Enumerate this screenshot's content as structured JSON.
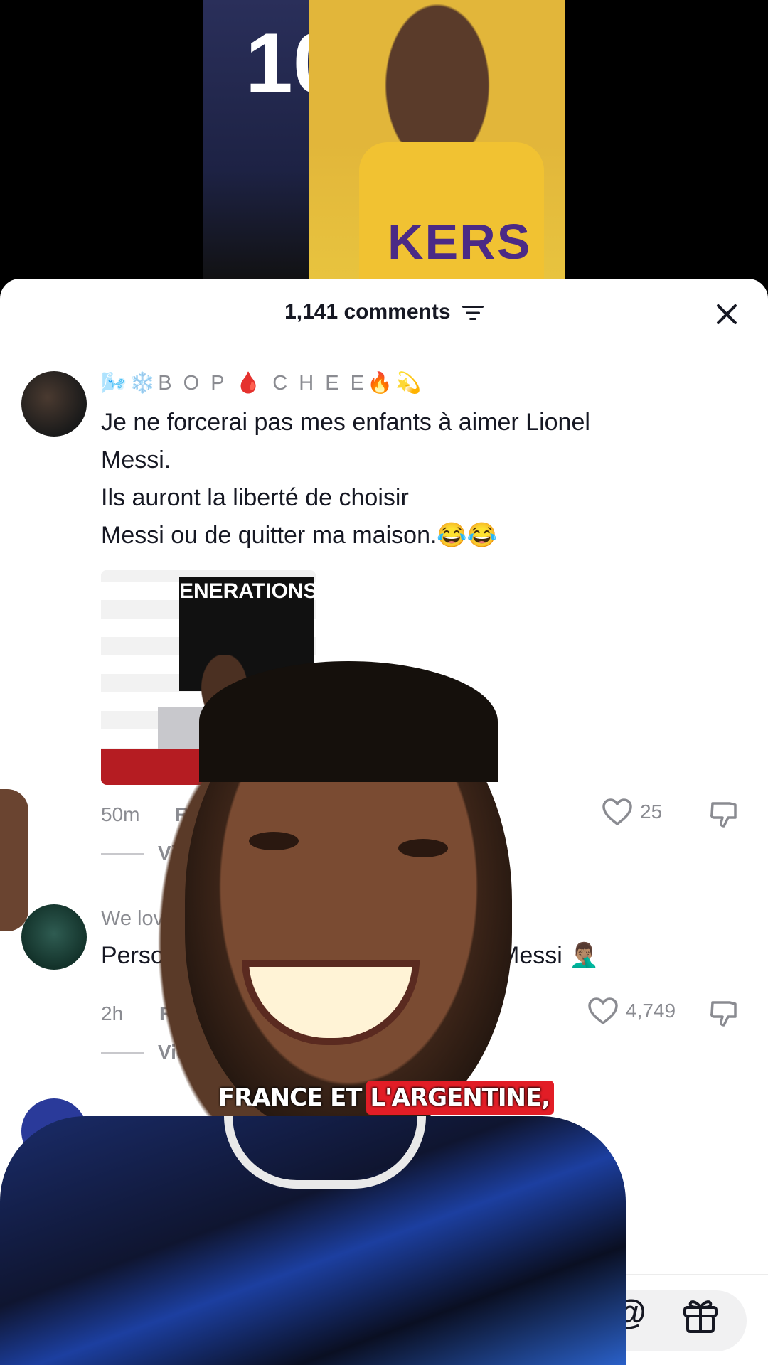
{
  "video": {
    "jersey_number": "10",
    "jersey_text": "KERS"
  },
  "sheet": {
    "comments_count": "1,141 comments"
  },
  "comments": [
    {
      "username": "🌬️❄️B O P 🩸 C H E E🔥💫",
      "text": "Je ne forcerai pas mes enfants à aimer Lionel\nMessi.\nIls auront la liberté de choisir\nMessi ou de quitter ma maison.😂😂",
      "gif_text": "ENERATIONS",
      "time": "50m",
      "reply_label": "Rep",
      "likes": "25",
      "view_label": "View"
    },
    {
      "username": "We love",
      "text_left": "Person",
      "text_right": "Messi 🤦🏽‍♂️",
      "time": "2h",
      "reply_label": "Re",
      "likes": "4,749",
      "view_label": "View"
    }
  ],
  "input": {
    "at_symbol": "@"
  },
  "caption": {
    "part1": "FRANCE ET",
    "part2": "L'ARGENTINE,"
  },
  "colors": {
    "caption_highlight": "#e21d26",
    "muted_text": "#8a8b91"
  }
}
